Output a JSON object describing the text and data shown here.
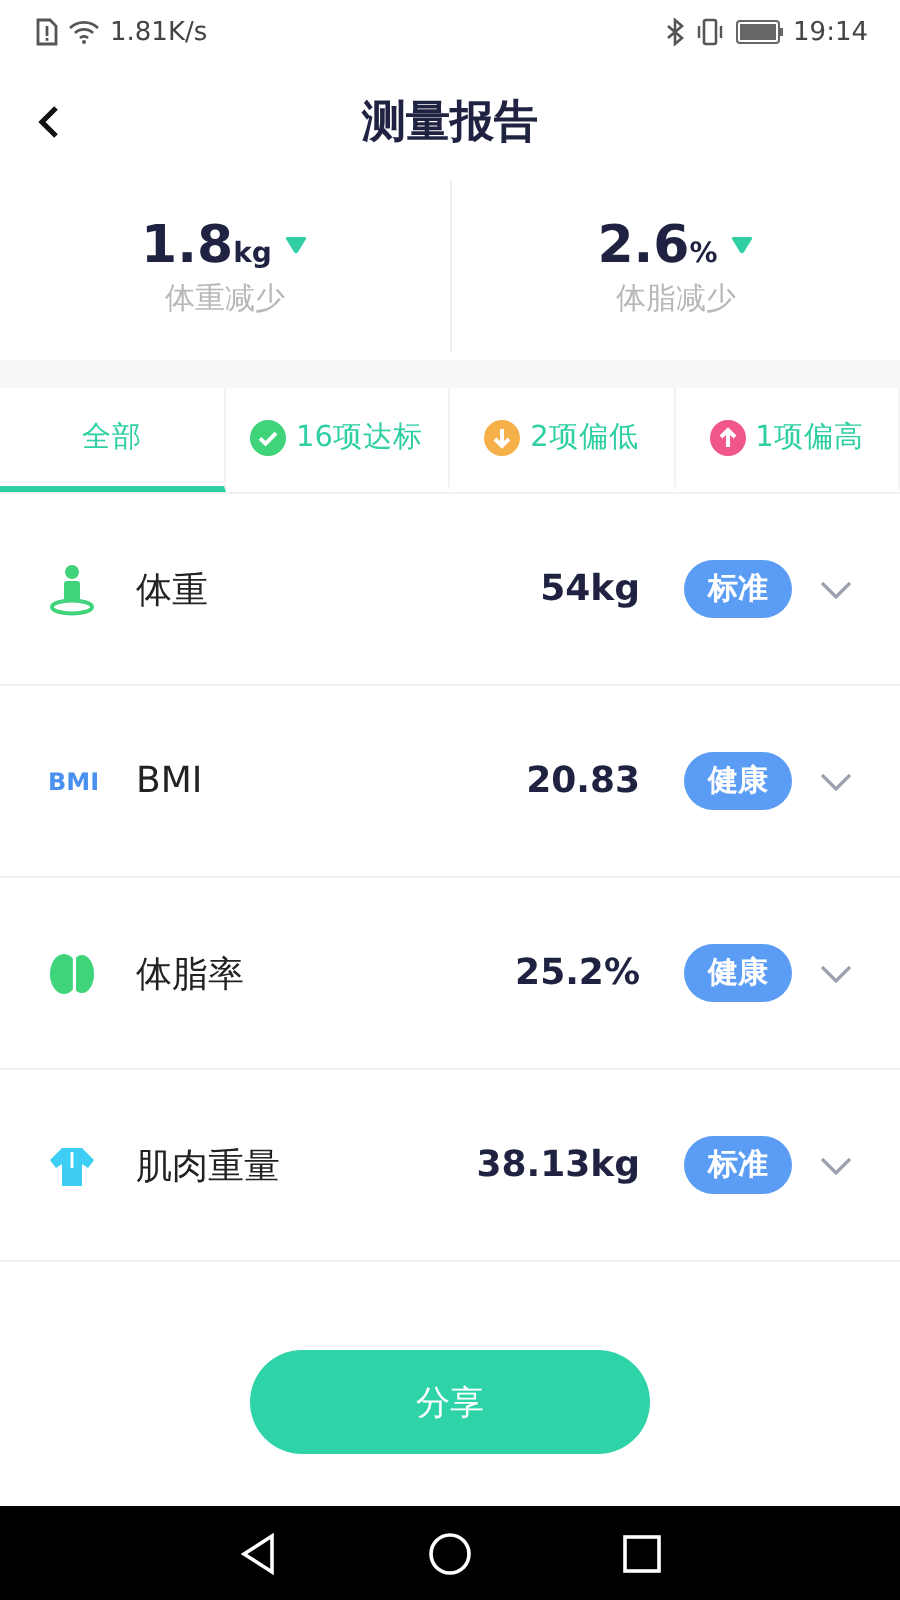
{
  "status_bar": {
    "speed": "1.81K/s",
    "time": "19:14"
  },
  "header": {
    "title": "测量报告"
  },
  "summary": [
    {
      "value": "1.8",
      "unit": "kg",
      "decreased": true,
      "label": "体重减少"
    },
    {
      "value": "2.6",
      "unit": "%",
      "decreased": true,
      "label": "体脂减少"
    }
  ],
  "tabs": [
    {
      "label": "全部",
      "selected": true
    },
    {
      "label": "16项达标",
      "kind": "check",
      "color": "#3fd37a",
      "selected": false
    },
    {
      "label": "2项偏低",
      "kind": "down",
      "color": "#f6b04a",
      "selected": false
    },
    {
      "label": "1项偏高",
      "kind": "up",
      "color": "#f0568c",
      "selected": false
    }
  ],
  "metrics": [
    {
      "kind": "person",
      "name": "体重",
      "value": "54kg",
      "badge": "标准",
      "expanded": false
    },
    {
      "kind": "bmi",
      "icon_text": "BMI",
      "name": "BMI",
      "value": "20.83",
      "badge": "健康",
      "expanded": false
    },
    {
      "kind": "fat",
      "name": "体脂率",
      "value": "25.2%",
      "badge": "健康",
      "expanded": false
    },
    {
      "kind": "muscle",
      "name": "肌肉重量",
      "value": "38.13kg",
      "badge": "标准",
      "expanded": false
    }
  ],
  "share_button": "分享"
}
